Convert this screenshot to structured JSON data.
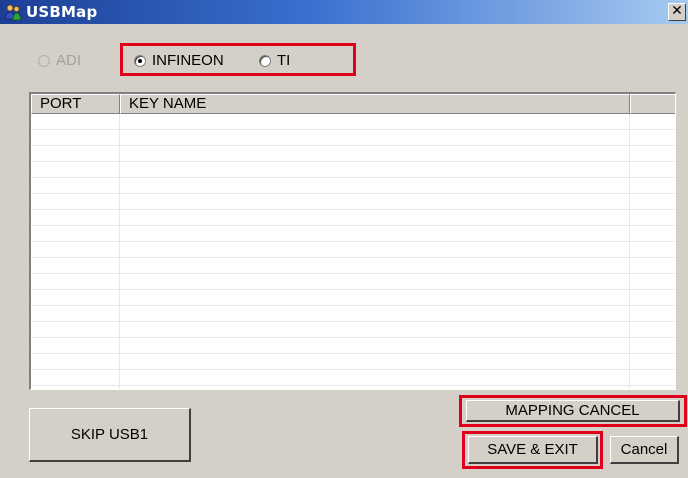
{
  "window": {
    "title": "USBMap",
    "close_glyph": "✕"
  },
  "radios": [
    {
      "label": "ADI",
      "selected": false,
      "disabled": true
    },
    {
      "label": "INFINEON",
      "selected": true,
      "disabled": false
    },
    {
      "label": "TI",
      "selected": false,
      "disabled": false
    }
  ],
  "list": {
    "columns": [
      "PORT",
      "KEY NAME",
      ""
    ],
    "rows": []
  },
  "buttons": {
    "skip_usb1": "SKIP USB1",
    "mapping_cancel": "MAPPING CANCEL",
    "save_exit": "SAVE & EXIT",
    "cancel": "Cancel"
  },
  "colors": {
    "highlight_box": "#e0001b",
    "titlebar_start": "#1c3f95",
    "titlebar_end": "#a6caf0",
    "dialog_bg": "#d4d0c8"
  },
  "icons": {
    "app": "people-icon",
    "close": "close-icon"
  }
}
